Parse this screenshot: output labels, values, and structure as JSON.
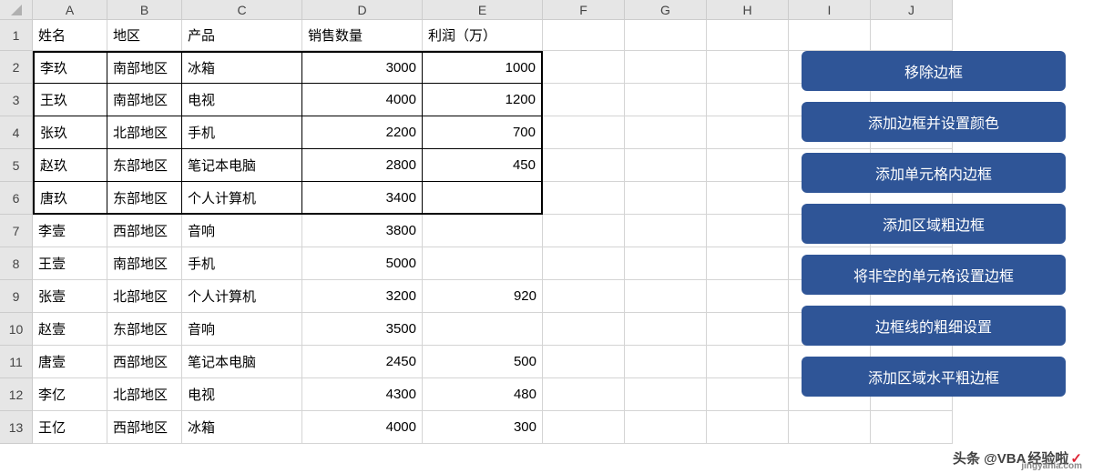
{
  "columns": [
    "A",
    "B",
    "C",
    "D",
    "E",
    "F",
    "G",
    "H",
    "I",
    "J"
  ],
  "rownums": [
    1,
    2,
    3,
    4,
    5,
    6,
    7,
    8,
    9,
    10,
    11,
    12,
    13
  ],
  "headers": {
    "A": "姓名",
    "B": "地区",
    "C": "产品",
    "D": "销售数量",
    "E": "利润（万）"
  },
  "rows": [
    {
      "A": "李玖",
      "B": "南部地区",
      "C": "冰箱",
      "D": "3000",
      "E": "1000"
    },
    {
      "A": "王玖",
      "B": "南部地区",
      "C": "电视",
      "D": "4000",
      "E": "1200"
    },
    {
      "A": "张玖",
      "B": "北部地区",
      "C": "手机",
      "D": "2200",
      "E": "700"
    },
    {
      "A": "赵玖",
      "B": "东部地区",
      "C": "笔记本电脑",
      "D": "2800",
      "E": "450"
    },
    {
      "A": "唐玖",
      "B": "东部地区",
      "C": "个人计算机",
      "D": "3400",
      "E": ""
    },
    {
      "A": "李壹",
      "B": "西部地区",
      "C": "音响",
      "D": "3800",
      "E": ""
    },
    {
      "A": "王壹",
      "B": "南部地区",
      "C": "手机",
      "D": "5000",
      "E": ""
    },
    {
      "A": "张壹",
      "B": "北部地区",
      "C": "个人计算机",
      "D": "3200",
      "E": "920"
    },
    {
      "A": "赵壹",
      "B": "东部地区",
      "C": "音响",
      "D": "3500",
      "E": ""
    },
    {
      "A": "唐壹",
      "B": "西部地区",
      "C": "笔记本电脑",
      "D": "2450",
      "E": "500"
    },
    {
      "A": "李亿",
      "B": "北部地区",
      "C": "电视",
      "D": "4300",
      "E": "480"
    },
    {
      "A": "王亿",
      "B": "西部地区",
      "C": "冰箱",
      "D": "4000",
      "E": "300"
    }
  ],
  "buttons": [
    "移除边框",
    "添加边框并设置颜色",
    "添加单元格内边框",
    "添加区域粗边框",
    "将非空的单元格设置边框",
    "边框线的粗细设置",
    "添加区域水平粗边框"
  ],
  "watermark": {
    "prefix": "头条 @VBA",
    "mid": "经验啦",
    "domain": "jingyanla.com"
  }
}
